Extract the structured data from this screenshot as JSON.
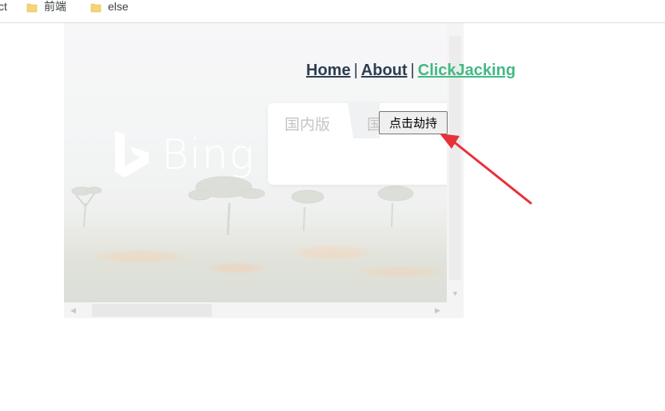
{
  "bookmarks": {
    "items": [
      {
        "label": "ct",
        "icon": "none"
      },
      {
        "label": "前端",
        "icon": "folder-icon"
      },
      {
        "label": "else",
        "icon": "folder-icon"
      }
    ]
  },
  "iframe": {
    "bing_word": "Bing",
    "tabs": [
      {
        "label": "国内版"
      },
      {
        "label": "国"
      }
    ]
  },
  "nav": {
    "home": "Home",
    "about": "About",
    "clickjacking": "ClickJacking",
    "separator": "|"
  },
  "hijack_button": {
    "label": "点击劫持"
  },
  "colors": {
    "nav_link": "#2c3e50",
    "nav_active": "#42b983",
    "annotation_arrow": "#e8303a",
    "folder": "#f6d375"
  }
}
